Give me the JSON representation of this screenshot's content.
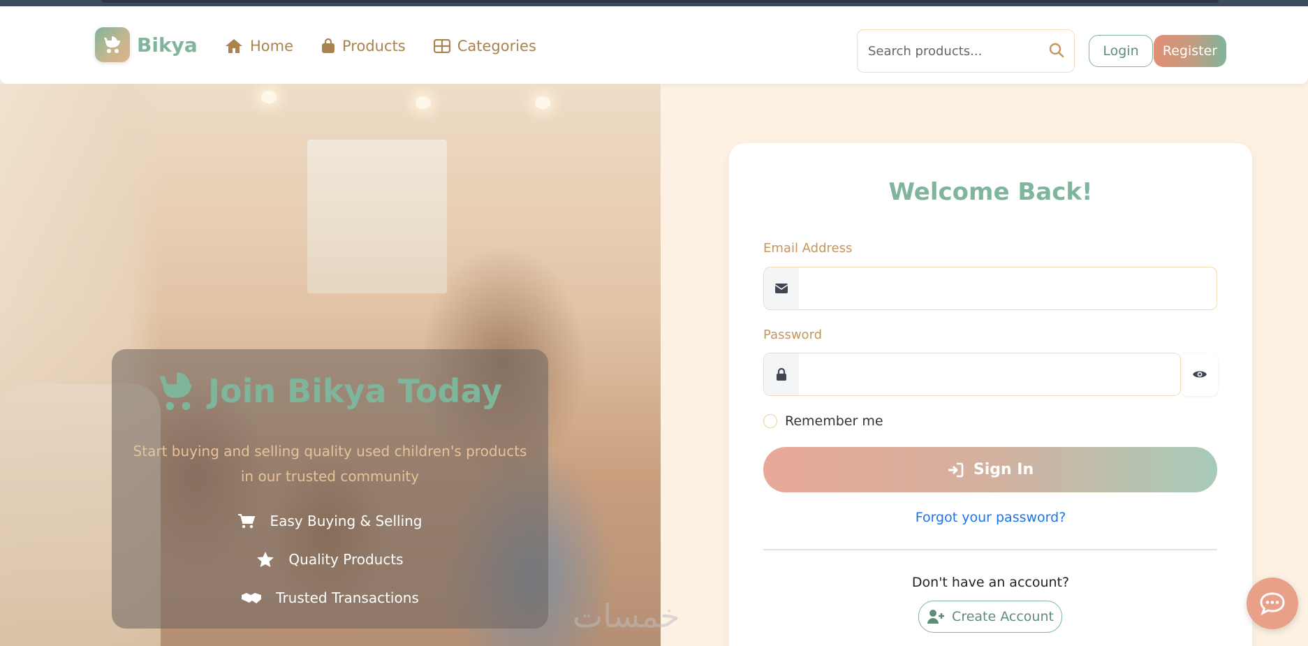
{
  "brand": {
    "name": "Bikya"
  },
  "nav": {
    "home": "Home",
    "products": "Products",
    "categories": "Categories"
  },
  "search": {
    "placeholder": "Search products..."
  },
  "auth": {
    "login": "Login",
    "register": "Register"
  },
  "hero": {
    "title": "Join Bikya Today",
    "subtitle": "Start buying and selling quality used children's products in our trusted community",
    "features": [
      "Easy Buying & Selling",
      "Quality Products",
      "Trusted Transactions"
    ]
  },
  "form": {
    "title": "Welcome Back!",
    "email_label": "Email Address",
    "email_value": "",
    "password_label": "Password",
    "password_value": "",
    "remember": "Remember me",
    "signin": "Sign In",
    "forgot": "Forgot your password?",
    "no_account": "Don't have an account?",
    "create": "Create Account"
  },
  "watermark": "خمسات",
  "colors": {
    "brand_green": "#7fb59b",
    "accent_tan": "#a88350",
    "link_blue": "#1a73e8",
    "page_bg": "#fcf1e2"
  },
  "icons": [
    "baby-carriage-icon",
    "home-icon",
    "shopping-bag-icon",
    "grid-icon",
    "search-icon",
    "cart-icon",
    "star-icon",
    "handshake-icon",
    "envelope-icon",
    "lock-icon",
    "eye-icon",
    "sign-in-icon",
    "user-plus-icon",
    "chat-icon"
  ]
}
